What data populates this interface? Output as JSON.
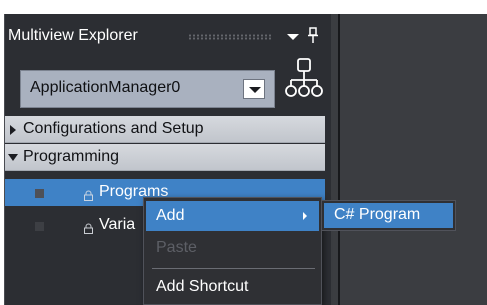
{
  "panel": {
    "title": "Multiview Explorer",
    "pin_glyph": "📌"
  },
  "device_selector": {
    "value": "ApplicationManager0"
  },
  "tree": {
    "items": [
      {
        "label": "Configurations and Setup",
        "expanded": false
      },
      {
        "label": "Programming",
        "expanded": true
      },
      {
        "label": "Programs",
        "selected": true
      },
      {
        "label": "Varia"
      }
    ]
  },
  "context_menu": {
    "items": [
      {
        "label": "Add",
        "enabled": true,
        "has_submenu": true
      },
      {
        "label": "Paste",
        "enabled": false
      },
      {
        "label": "Add Shortcut",
        "enabled": true
      }
    ]
  },
  "submenu": {
    "items": [
      {
        "label": "C# Program"
      }
    ]
  },
  "colors": {
    "selection": "#3f82c6",
    "panel_bg": "#2c2e33",
    "tree_header_bg": "#c9ccd2",
    "combo_bg": "#a9b1bf"
  },
  "icons": {
    "title_dropdown": "chevron-down-icon",
    "title_pin": "pin-icon",
    "combo_dropdown": "chevron-down-icon",
    "hierarchy": "hierarchy-icon",
    "expand_collapsed": "triangle-right-icon",
    "expand_expanded": "triangle-down-icon",
    "program_item": "lock-icon",
    "submenu_arrow": "chevron-right-icon"
  }
}
